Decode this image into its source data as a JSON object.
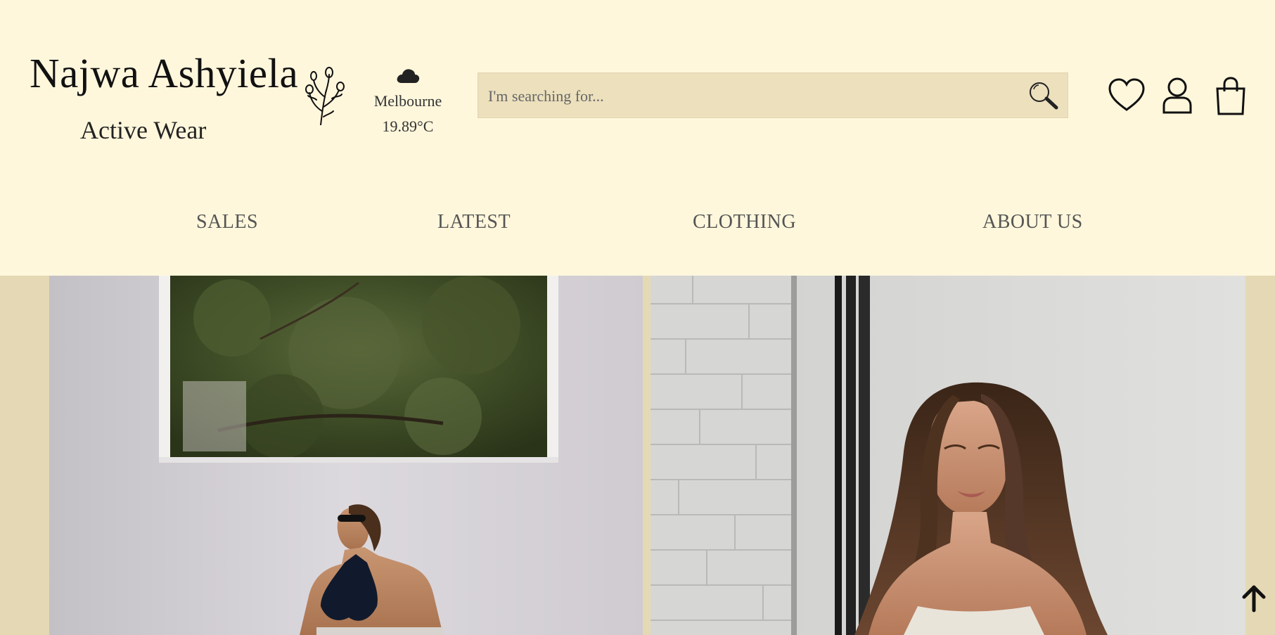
{
  "brand": {
    "name": "Najwa Ashyiela",
    "subtitle": "Active Wear"
  },
  "weather": {
    "icon": "cloud-icon",
    "city": "Melbourne",
    "temperature": "19.89°C"
  },
  "search": {
    "placeholder": "I'm searching for...",
    "value": ""
  },
  "header_icons": [
    "heart-icon",
    "user-icon",
    "shopping-bag-icon"
  ],
  "nav": {
    "items": [
      {
        "label": "SALES"
      },
      {
        "label": "LATEST"
      },
      {
        "label": "CLOTHING"
      },
      {
        "label": "ABOUT US"
      }
    ]
  },
  "gallery": {
    "photos": [
      "woman-bikini-window-photo",
      "woman-long-hair-photo"
    ]
  },
  "back_to_top": {
    "icon": "arrow-up-icon"
  },
  "colors": {
    "background": "#fff7dc",
    "search_bg": "#ece0bd",
    "gallery_bg": "#e5d9b5",
    "text": "#222222"
  }
}
